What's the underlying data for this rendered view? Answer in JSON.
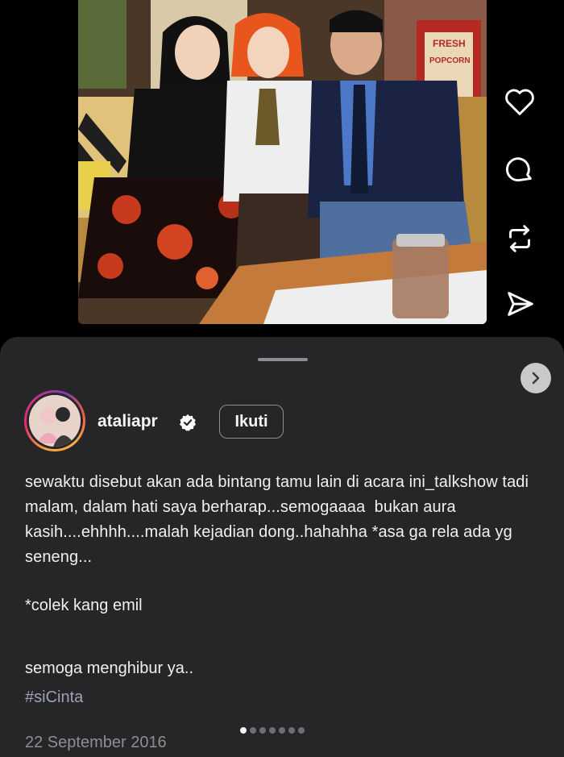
{
  "post": {
    "username": "ataliapr",
    "verified": true,
    "follow_label": "Ikuti",
    "caption_main": "sewaktu disebut akan ada bintang tamu lain di acara ini_talkshow tadi malam, dalam hati saya berharap...semogaaaa  bukan aura kasih....ehhhh....malah kejadian dong..hahahha *asa ga rela ada yg seneng...",
    "caption_colek": "*colek kang emil",
    "caption_closing": "semoga menghibur ya..",
    "hashtag": "#siCinta",
    "date": "22 September 2016",
    "carousel": {
      "count": 7,
      "active_index": 0
    }
  },
  "photo_props": {
    "popcorn_sign_1": "FRESH",
    "popcorn_sign_2": "POPCORN"
  },
  "actions": {
    "like_icon": "heart-icon",
    "comment_icon": "comment-icon",
    "repost_icon": "repost-icon",
    "share_icon": "send-icon"
  },
  "colors": {
    "sheet_bg": "#262628",
    "accent_ring": "#e1306c",
    "verified_badge": "#ffffff",
    "hashtag": "#9aa3b2"
  }
}
